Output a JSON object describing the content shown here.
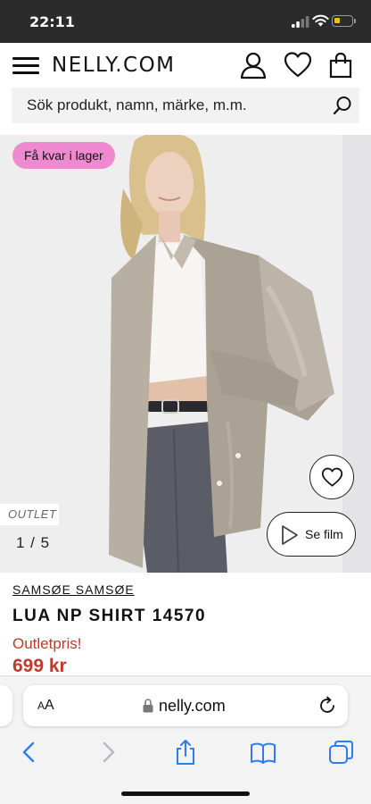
{
  "status_bar": {
    "time": "22:11",
    "battery_color": "#f2c200"
  },
  "header": {
    "logo": "NELLY.COM",
    "icons": [
      "menu-icon",
      "account-icon",
      "heart-icon",
      "bag-icon"
    ]
  },
  "search": {
    "placeholder": "Sök produkt, namn, märke, m.m."
  },
  "gallery": {
    "stock_badge": "Få kvar i lager",
    "outlet_tag": "OUTLET",
    "counter": "1 / 5",
    "film_button": "Se film",
    "badge_color": "#f08ad0"
  },
  "product": {
    "brand": "SAMSØE SAMSØE",
    "name": "LUA NP SHIRT 14570",
    "outlet_label": "Outletpris!",
    "price": "699 kr",
    "price_color": "#c0392b"
  },
  "browser": {
    "text_size": "AA",
    "url": "nelly.com",
    "toolbar_icons": [
      "back-icon",
      "forward-icon",
      "share-icon",
      "bookmarks-icon",
      "tabs-icon"
    ]
  }
}
